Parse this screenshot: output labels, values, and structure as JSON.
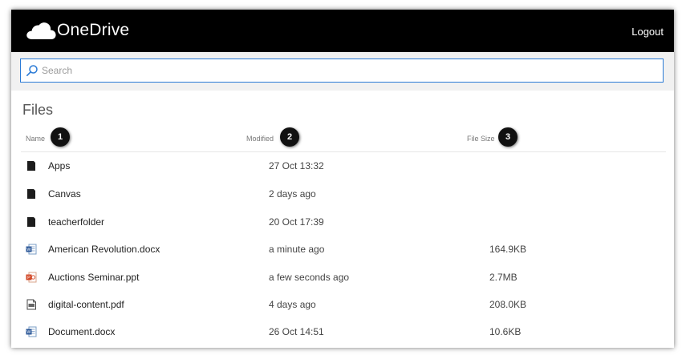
{
  "header": {
    "brand": "OneDrive",
    "logout_label": "Logout",
    "logo_icon": "cloud-icon",
    "background": "#000000"
  },
  "search": {
    "placeholder": "Search",
    "value": "",
    "icon": "search-icon",
    "border_color": "#2b7bd6"
  },
  "files": {
    "title": "Files",
    "columns": {
      "name": {
        "label": "Name",
        "badge": "1"
      },
      "modified": {
        "label": "Modified",
        "badge": "2"
      },
      "size": {
        "label": "File Size",
        "badge": "3"
      }
    },
    "rows": [
      {
        "name": "Apps",
        "modified": "27 Oct 13:32",
        "size": "",
        "icon": "folder-icon"
      },
      {
        "name": "Canvas",
        "modified": "2 days ago",
        "size": "",
        "icon": "folder-icon"
      },
      {
        "name": "teacherfolder",
        "modified": "20 Oct 17:39",
        "size": "",
        "icon": "folder-icon"
      },
      {
        "name": "American Revolution.docx",
        "modified": "a minute ago",
        "size": "164.9KB",
        "icon": "word-doc-icon"
      },
      {
        "name": "Auctions Seminar.ppt",
        "modified": "a few seconds ago",
        "size": "2.7MB",
        "icon": "powerpoint-icon"
      },
      {
        "name": "digital-content.pdf",
        "modified": "4 days ago",
        "size": "208.0KB",
        "icon": "pdf-icon"
      },
      {
        "name": "Document.docx",
        "modified": "26 Oct 14:51",
        "size": "10.6KB",
        "icon": "word-doc-icon"
      }
    ]
  }
}
